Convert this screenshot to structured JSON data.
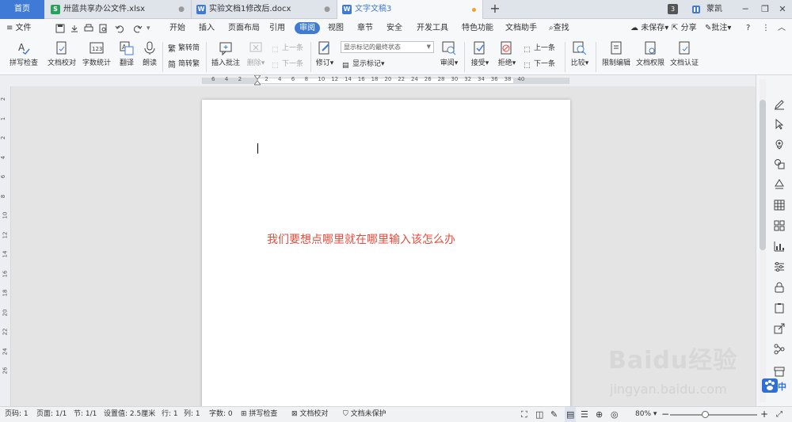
{
  "colors": {
    "accent": "#3f7bd6",
    "red_text": "#e84c3d",
    "sheet_green": "#2aa15a",
    "word_blue": "#3f7bd6",
    "unsaved_dot": "#f0a030"
  },
  "tabs": {
    "home": "首页",
    "items": [
      {
        "label": "卅蓝共享办公文件.xlsx",
        "icon": "spreadsheet-icon",
        "icon_letter": "S"
      },
      {
        "label": "实验文档1修改后.docx",
        "icon": "document-icon",
        "icon_letter": "W"
      },
      {
        "label": "文字文稿3",
        "icon": "document-icon",
        "icon_letter": "W"
      }
    ],
    "add": "+",
    "window_count": "3",
    "user_name": "蒙凯"
  },
  "menu": {
    "file": "≡ 文件",
    "items": [
      "开始",
      "插入",
      "页面布局",
      "引用",
      "审阅",
      "视图",
      "章节",
      "安全",
      "开发工具",
      "特色功能",
      "文档助手"
    ],
    "active": "审阅",
    "search": "查找",
    "right": {
      "save": "未保存",
      "share": "分享",
      "comment": "批注",
      "help": "?"
    }
  },
  "ribbon": {
    "spell_check": "拼写检查",
    "doc_proof": "文档校对",
    "word_count": "字数统计",
    "translate": "翻译",
    "read_aloud": "朗读",
    "to_traditional": "繁转简",
    "to_simplified": "简转繁",
    "insert_comment": "插入批注",
    "delete": "删除",
    "prev_comment": "上一条",
    "next_comment": "下一条",
    "revise": "修订",
    "show_markup_select": "显示标记的最终状态",
    "show_markup": "显示标记",
    "review": "审阅",
    "accept": "接受",
    "reject": "拒绝",
    "prev_change": "上一条",
    "next_change": "下一条",
    "compare": "比较",
    "restrict_edit": "限制编辑",
    "doc_permission": "文档权限",
    "doc_certify": "文档认证"
  },
  "ruler": {
    "h_ticks": [
      "6",
      "4",
      "2",
      "",
      "2",
      "4",
      "6",
      "8",
      "10",
      "12",
      "14",
      "16",
      "18",
      "20",
      "22",
      "24",
      "26",
      "28",
      "30",
      "32",
      "34",
      "36",
      "38",
      "40"
    ],
    "v_ticks": [
      "2",
      "1",
      "2",
      "4",
      "6",
      "8",
      "10",
      "12",
      "14",
      "16",
      "18",
      "20",
      "22",
      "24",
      "26"
    ]
  },
  "document": {
    "content": "我们要想点哪里就在哪里输入该怎么办"
  },
  "status": {
    "page_num": "页码: 1",
    "page_count": "页面: 1/1",
    "section": "节: 1/1",
    "position": "设置值: 2.5厘米",
    "row": "行: 1",
    "col": "列: 1",
    "word_count": "字数: 0",
    "spell_check": "拼写检查",
    "doc_proof": "文档校对",
    "doc_protect": "文档未保护",
    "zoom": "80%",
    "zoom_out": "−",
    "zoom_in": "+"
  },
  "watermark": {
    "brand": "Baidu经验",
    "url": "jingyan.baidu.com",
    "ime": "中"
  }
}
